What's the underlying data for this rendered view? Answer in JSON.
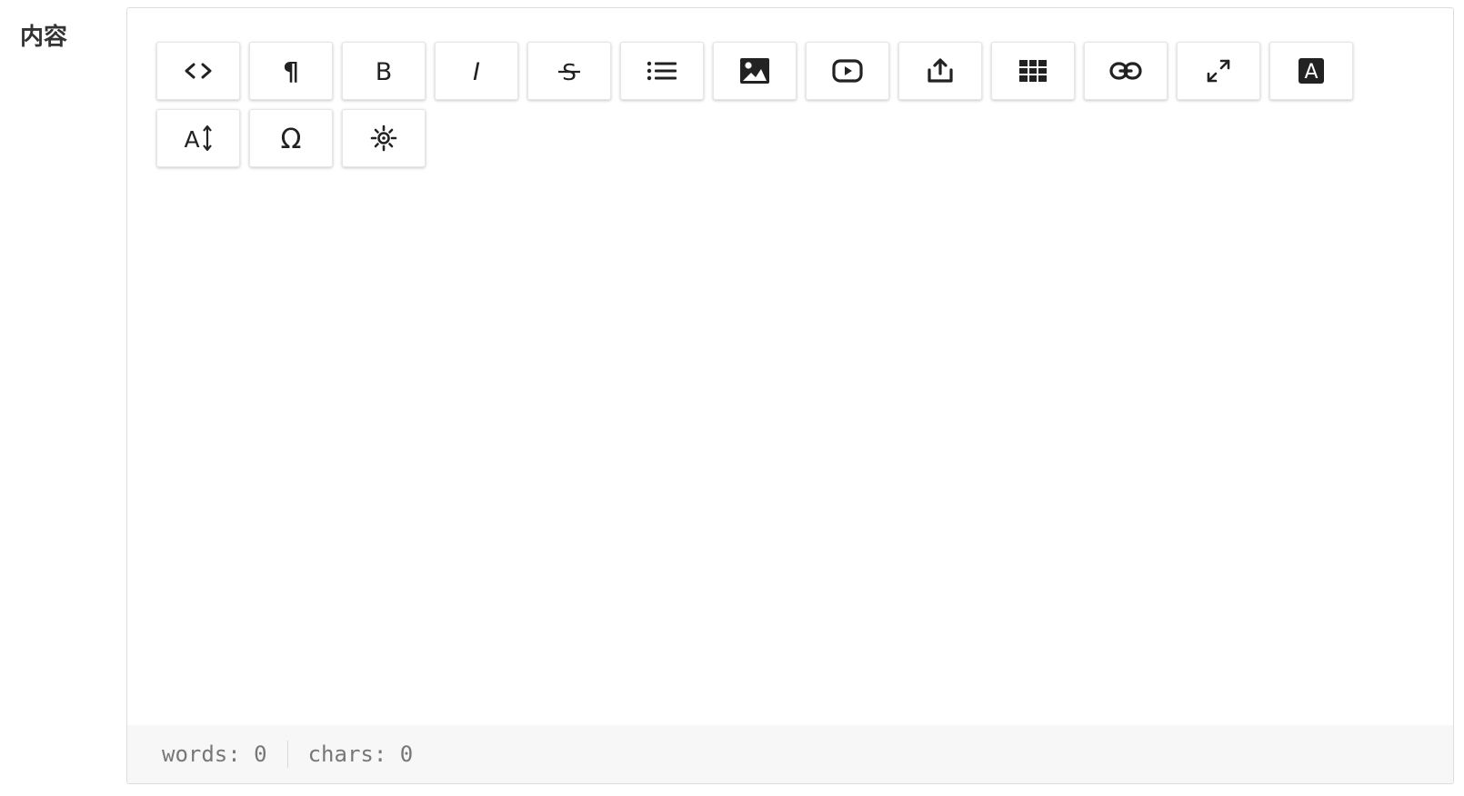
{
  "field": {
    "label": "内容"
  },
  "toolbar": {
    "buttons": [
      {
        "name": "html-code",
        "icon": "code-icon"
      },
      {
        "name": "paragraph",
        "icon": "pilcrow-icon",
        "glyph": "¶"
      },
      {
        "name": "bold",
        "icon": "bold-icon",
        "glyph": "B"
      },
      {
        "name": "italic",
        "icon": "italic-icon",
        "glyph": "I"
      },
      {
        "name": "strikethrough",
        "icon": "strikethrough-icon",
        "glyph": "S"
      },
      {
        "name": "list",
        "icon": "list-icon"
      },
      {
        "name": "image",
        "icon": "image-icon"
      },
      {
        "name": "video",
        "icon": "video-icon"
      },
      {
        "name": "upload-file",
        "icon": "upload-icon"
      },
      {
        "name": "table",
        "icon": "table-icon"
      },
      {
        "name": "link",
        "icon": "link-icon"
      },
      {
        "name": "fullscreen",
        "icon": "expand-icon"
      },
      {
        "name": "text-color",
        "icon": "text-color-icon",
        "glyph": "A"
      },
      {
        "name": "line-height",
        "icon": "line-height-icon",
        "glyph": "A"
      },
      {
        "name": "special-characters",
        "icon": "omega-icon",
        "glyph": "Ω"
      },
      {
        "name": "emoji",
        "icon": "sparkle-icon"
      }
    ]
  },
  "status": {
    "words": "words: 0",
    "chars": "chars: 0"
  },
  "colors": {
    "icon": "#222222",
    "border": "#dddddd",
    "status_text": "#777777",
    "status_bg": "#f7f7f7"
  }
}
